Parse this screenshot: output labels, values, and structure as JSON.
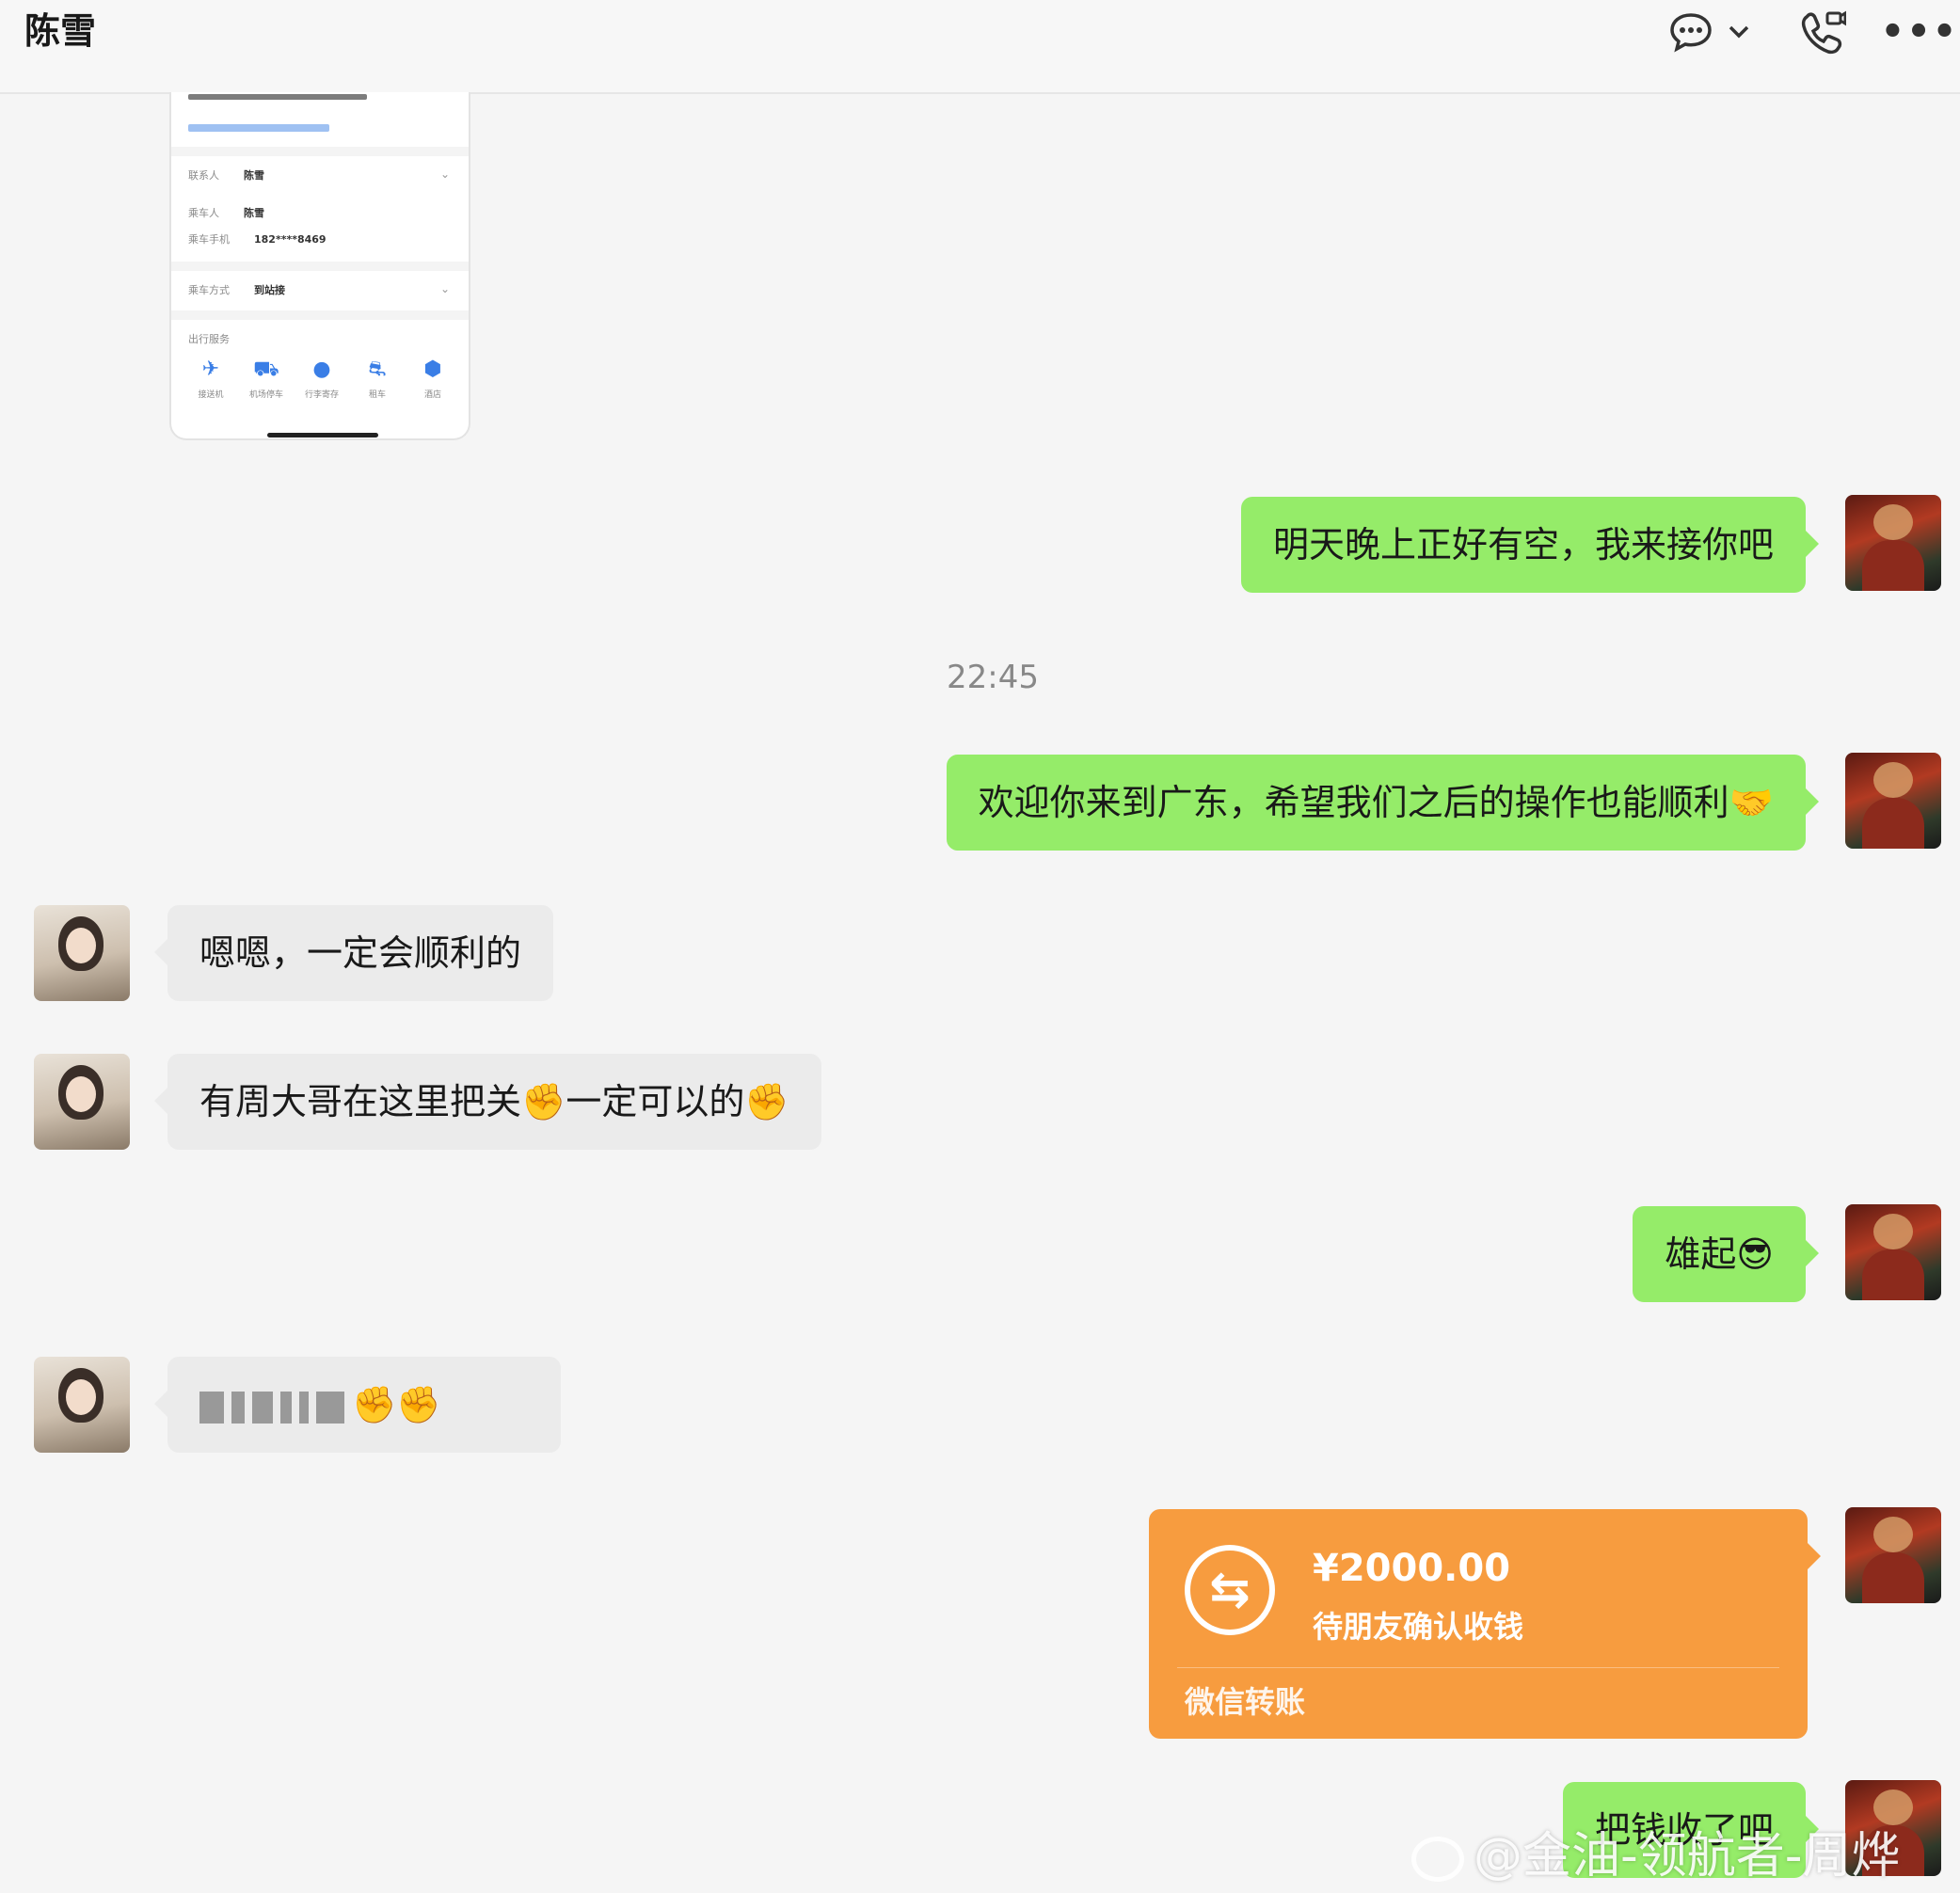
{
  "header": {
    "title": "陈雪",
    "icons": [
      "chat-bubble-icon",
      "chevron-down-icon",
      "phone-video-icon",
      "more-icon"
    ]
  },
  "shared_screenshot": {
    "fields": [
      {
        "label": "联系人",
        "value": "陈雪"
      },
      {
        "label": "乘车人",
        "value": "陈雪"
      },
      {
        "label": "乘车手机",
        "value": "182****8469"
      },
      {
        "label": "乘车方式",
        "value": "到站接"
      }
    ],
    "section_title": "出行服务",
    "services": [
      "接送机",
      "机场停车",
      "行李寄存",
      "租车",
      "酒店"
    ]
  },
  "messages": [
    {
      "id": "m1",
      "sender": "me",
      "text": "明天晚上正好有空，我来接你吧"
    },
    {
      "id": "t1",
      "type": "time",
      "text": "22:45"
    },
    {
      "id": "m2",
      "sender": "me",
      "text": "欢迎你来到广东，希望我们之后的操作也能顺利🤝"
    },
    {
      "id": "m3",
      "sender": "her",
      "text": "嗯嗯，一定会顺利的"
    },
    {
      "id": "m4",
      "sender": "her",
      "text": "有周大哥在这里把关✊一定可以的✊"
    },
    {
      "id": "m5",
      "sender": "me",
      "text": "雄起😎"
    },
    {
      "id": "m6",
      "sender": "her",
      "text": "✊✊",
      "blurred": true
    },
    {
      "id": "m7",
      "sender": "me",
      "type": "transfer",
      "amount": "¥2000.00",
      "status": "待朋友确认收钱",
      "label": "微信转账"
    },
    {
      "id": "m8",
      "sender": "me",
      "text": "把钱收了吧"
    }
  ],
  "watermark": "@金油-领航者-周烨",
  "colors": {
    "my_bubble": "#95ec69",
    "her_bubble": "#ebebeb",
    "transfer": "#f79c3f",
    "background": "#f5f5f5"
  }
}
